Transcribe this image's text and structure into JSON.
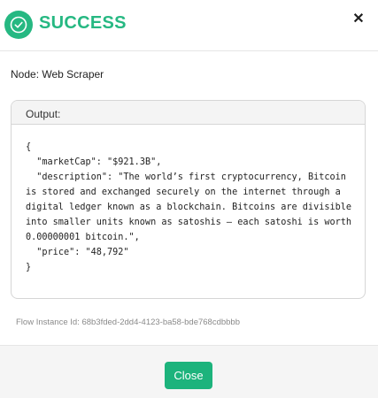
{
  "header": {
    "title": "SUCCESS",
    "status_icon": "check-circle-icon",
    "close_symbol": "✕",
    "close_icon": "close-icon"
  },
  "node": {
    "label": "Node: Web Scraper"
  },
  "output": {
    "label": "Output:",
    "content": "{\n  \"marketCap\": \"$921.3B\",\n  \"description\": \"The world’s first cryptocurrency, Bitcoin is stored and exchanged securely on the internet through a digital ledger known as a blockchain. Bitcoins are divisible into smaller units known as satoshis — each satoshi is worth 0.00000001 bitcoin.\",\n  \"price\": \"48,792\"\n}"
  },
  "flow_instance": {
    "text": "Flow Instance Id: 68b3fded-2dd4-4123-ba58-bde768cdbbbb"
  },
  "footer": {
    "close_label": "Close"
  },
  "colors": {
    "accent": "#26b882",
    "title_text": "#26b882",
    "button_bg": "#1db37c"
  }
}
